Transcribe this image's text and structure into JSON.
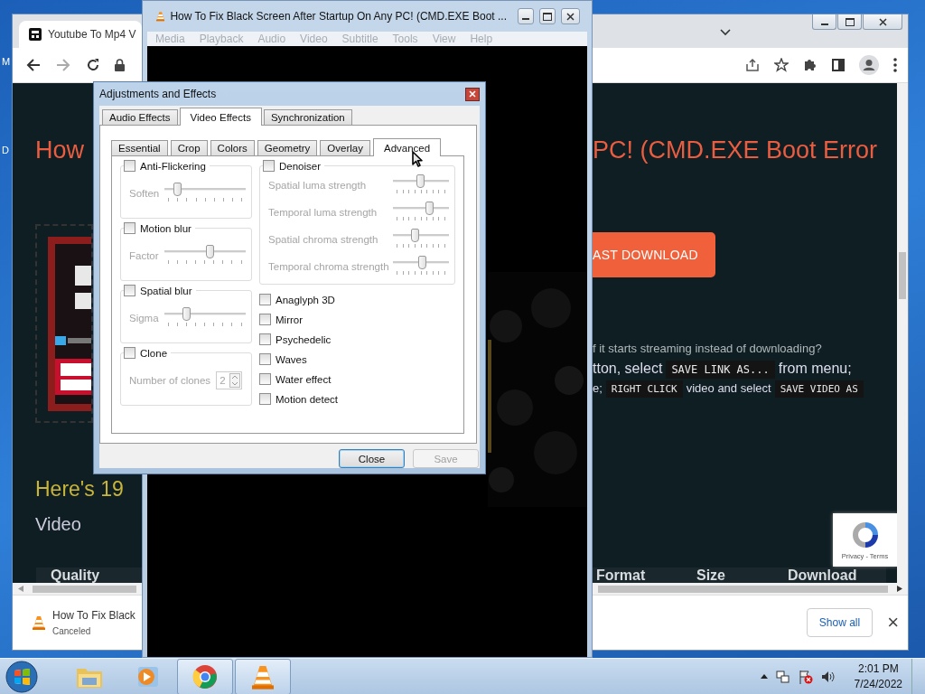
{
  "desktop": {
    "icon_labels": [
      "M",
      "D"
    ]
  },
  "browser": {
    "tab_title": "Youtube To Mp4 V",
    "page": {
      "heading_left": "How",
      "heading_right": "PC! (CMD.EXE Boot Error",
      "download_button": "AST DOWNLOAD",
      "note": "f it starts streaming instead of downloading?",
      "instruction_lines": [
        [
          {
            "kind": "text",
            "text": "tton, select"
          },
          {
            "kind": "code",
            "text": "SAVE LINK AS..."
          },
          {
            "kind": "text",
            "text": "from menu;"
          }
        ],
        [
          {
            "kind": "text",
            "text": "e;"
          },
          {
            "kind": "code",
            "text": "RIGHT CLICK"
          },
          {
            "kind": "text",
            "text": "video and select"
          },
          {
            "kind": "code",
            "text": "SAVE VIDEO AS"
          }
        ]
      ],
      "section_heading": "Here's 19",
      "subheading": "Video",
      "table_columns": [
        "Quality",
        "Format",
        "Size",
        "Download"
      ],
      "recaptcha": "Privacy - Terms"
    },
    "download_bar": {
      "file": "How To Fix Black",
      "status": "Canceled",
      "show_all": "Show all",
      "close": "×"
    }
  },
  "vlc": {
    "title": "How To Fix Black Screen After Startup On Any PC! (CMD.EXE Boot ...",
    "menu": [
      {
        "label": "Media",
        "disabled": true
      },
      {
        "label": "Playback",
        "disabled": true
      },
      {
        "label": "Audio",
        "disabled": true
      },
      {
        "label": "Video",
        "disabled": true
      },
      {
        "label": "Subtitle",
        "disabled": true
      },
      {
        "label": "Tools",
        "disabled": true
      },
      {
        "label": "View",
        "disabled": true
      },
      {
        "label": "Help",
        "disabled": true
      }
    ]
  },
  "dialog": {
    "title": "Adjustments and Effects",
    "tabs": [
      {
        "label": "Audio Effects",
        "selected": false
      },
      {
        "label": "Video Effects",
        "selected": true
      },
      {
        "label": "Synchronization",
        "selected": false
      }
    ],
    "subtabs": [
      {
        "label": "Essential",
        "selected": false
      },
      {
        "label": "Crop",
        "selected": false
      },
      {
        "label": "Colors",
        "selected": false
      },
      {
        "label": "Geometry",
        "selected": false
      },
      {
        "label": "Overlay",
        "selected": false
      },
      {
        "label": "Advanced",
        "selected": true
      }
    ],
    "groups": [
      {
        "kind": "slider",
        "label": "Anti-Flickering",
        "checked": false,
        "sliders": [
          {
            "label": "Soften",
            "level": 0.12
          }
        ]
      },
      {
        "kind": "slider",
        "label": "Motion blur",
        "checked": false,
        "sliders": [
          {
            "label": "Factor",
            "level": 0.58
          }
        ]
      },
      {
        "kind": "slider",
        "label": "Spatial blur",
        "checked": false,
        "sliders": [
          {
            "label": "Sigma",
            "level": 0.26
          }
        ]
      },
      {
        "kind": "spin",
        "label": "Clone",
        "checked": false,
        "spin": {
          "label": "Number of clones",
          "value": "2"
        }
      }
    ],
    "denoiser": {
      "label": "Denoiser",
      "checked": false,
      "sliders": [
        {
          "label": "Spatial luma strength",
          "level": 0.5
        },
        {
          "label": "Temporal luma strength",
          "level": 0.7
        },
        {
          "label": "Spatial chroma strength",
          "level": 0.38
        },
        {
          "label": "Temporal chroma strength",
          "level": 0.54
        }
      ]
    },
    "effects": [
      {
        "label": "Anaglyph 3D",
        "checked": false
      },
      {
        "label": "Mirror",
        "checked": false
      },
      {
        "label": "Psychedelic",
        "checked": false
      },
      {
        "label": "Waves",
        "checked": false
      },
      {
        "label": "Water effect",
        "checked": false
      },
      {
        "label": "Motion detect",
        "checked": false
      }
    ],
    "buttons": [
      {
        "label": "Close",
        "default": true,
        "disabled": false
      },
      {
        "label": "Save",
        "default": false,
        "disabled": true
      }
    ]
  },
  "taskbar": {
    "apps": [
      {
        "kind": "folder",
        "open": false
      },
      {
        "kind": "player",
        "open": false
      },
      {
        "kind": "browser",
        "open": true
      },
      {
        "kind": "cone",
        "open": true
      }
    ],
    "time": "2:01 PM",
    "date": "7/24/2022"
  }
}
